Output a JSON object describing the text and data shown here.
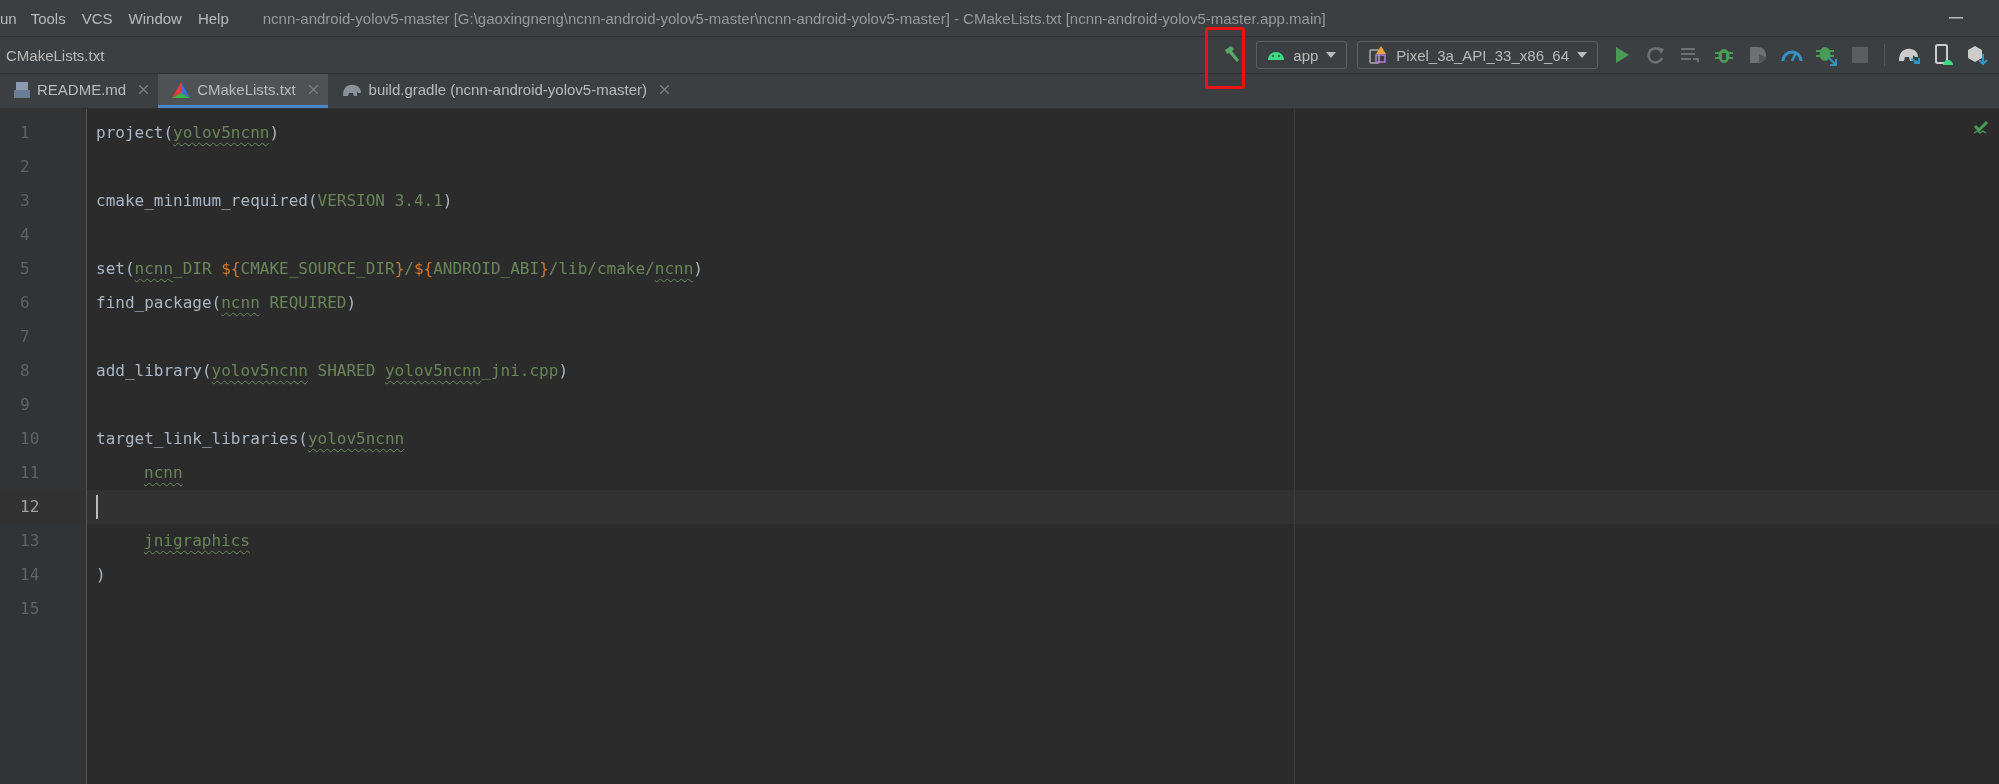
{
  "menu_bar": {
    "items": [
      "un",
      "Tools",
      "VCS",
      "Window",
      "Help"
    ],
    "title": "ncnn-android-yolov5-master [G:\\gaoxingneng\\ncnn-android-yolov5-master\\ncnn-android-yolov5-master] - CMakeLists.txt [ncnn-android-yolov5-master.app.main]"
  },
  "breadcrumb": "CMakeLists.txt",
  "toolbar": {
    "items": [
      {
        "kind": "build",
        "disabled": false,
        "highlighted": true
      },
      {
        "kind": "config",
        "label": "app"
      },
      {
        "kind": "device",
        "label": "Pixel_3a_API_33_x86_64"
      },
      {
        "kind": "run",
        "disabled": false,
        "highlighted": false
      },
      {
        "kind": "rerun",
        "disabled": true,
        "highlighted": false
      },
      {
        "kind": "apply",
        "disabled": true,
        "highlighted": false
      },
      {
        "kind": "debug",
        "disabled": false,
        "highlighted": false
      },
      {
        "kind": "attach",
        "disabled": true,
        "highlighted": false
      },
      {
        "kind": "profile",
        "disabled": false,
        "highlighted": false
      },
      {
        "kind": "attach-debugger",
        "disabled": false,
        "highlighted": false
      },
      {
        "kind": "stop",
        "disabled": true,
        "highlighted": false
      },
      {
        "kind": "sync",
        "disabled": false,
        "highlighted": false
      },
      {
        "kind": "device-manager",
        "disabled": false,
        "highlighted": false
      },
      {
        "kind": "sdk-manager",
        "disabled": false,
        "highlighted": false
      }
    ]
  },
  "tabs": [
    {
      "label": "README.md",
      "kind": "markdown",
      "selected": false
    },
    {
      "label": "CMakeLists.txt",
      "kind": "cmake",
      "selected": true
    },
    {
      "label": "build.gradle (ncnn-android-yolov5-master)",
      "kind": "gradle",
      "selected": false
    }
  ],
  "editor": {
    "lines": [
      {
        "number": "1",
        "current": false,
        "indented": false,
        "tokens": [
          {
            "t": "project(",
            "kind": "fn"
          },
          {
            "t": "yolov5ncnn",
            "kind": "typo"
          },
          {
            "t": ")",
            "kind": "fn"
          }
        ]
      },
      {
        "number": "2",
        "current": false
      },
      {
        "number": "3",
        "current": false,
        "indented": false,
        "tokens": [
          {
            "t": "cmake_minimum_required(",
            "kind": "fn"
          },
          {
            "t": "VERSION 3.4.1",
            "kind": "arg"
          },
          {
            "t": ")",
            "kind": "fn"
          }
        ]
      },
      {
        "number": "4",
        "current": false
      },
      {
        "number": "5",
        "current": false,
        "indented": false,
        "tokens": [
          {
            "t": "set(",
            "kind": "fn"
          },
          {
            "t": "ncnn",
            "kind": "typo"
          },
          {
            "t": "_DIR ",
            "kind": "arg"
          },
          {
            "t": "${",
            "kind": "var"
          },
          {
            "t": "CMAKE_SOURCE_DIR",
            "kind": "arg"
          },
          {
            "t": "}",
            "kind": "var"
          },
          {
            "t": "/",
            "kind": "arg"
          },
          {
            "t": "${",
            "kind": "var"
          },
          {
            "t": "ANDROID_ABI",
            "kind": "arg"
          },
          {
            "t": "}",
            "kind": "var"
          },
          {
            "t": "/lib/cmake/",
            "kind": "arg"
          },
          {
            "t": "ncnn",
            "kind": "typo"
          },
          {
            "t": ")",
            "kind": "fn"
          }
        ]
      },
      {
        "number": "6",
        "current": false,
        "indented": false,
        "tokens": [
          {
            "t": "find_package(",
            "kind": "fn"
          },
          {
            "t": "ncnn",
            "kind": "typo"
          },
          {
            "t": " REQUIRED",
            "kind": "arg"
          },
          {
            "t": ")",
            "kind": "fn"
          }
        ]
      },
      {
        "number": "7",
        "current": false
      },
      {
        "number": "8",
        "current": false,
        "indented": false,
        "tokens": [
          {
            "t": "add_library(",
            "kind": "fn"
          },
          {
            "t": "yolov5ncnn",
            "kind": "typo"
          },
          {
            "t": " SHARED ",
            "kind": "arg"
          },
          {
            "t": "yolov5ncnn",
            "kind": "typo"
          },
          {
            "t": "_jni.cpp",
            "kind": "arg"
          },
          {
            "t": ")",
            "kind": "fn"
          }
        ]
      },
      {
        "number": "9",
        "current": false
      },
      {
        "number": "10",
        "current": false,
        "indented": false,
        "tokens": [
          {
            "t": "target_link_libraries(",
            "kind": "fn"
          },
          {
            "t": "yolov5ncnn",
            "kind": "typo"
          }
        ]
      },
      {
        "number": "11",
        "current": false,
        "indented": true,
        "tokens": [
          {
            "t": "ncnn",
            "kind": "typo"
          }
        ]
      },
      {
        "number": "12",
        "current": true
      },
      {
        "number": "13",
        "current": false,
        "indented": true,
        "tokens": [
          {
            "t": "jnigraphics",
            "kind": "typo"
          }
        ]
      },
      {
        "number": "14",
        "current": false,
        "indented": false,
        "tokens": [
          {
            "t": ")",
            "kind": "fn"
          }
        ]
      },
      {
        "number": "15",
        "current": false
      }
    ]
  }
}
